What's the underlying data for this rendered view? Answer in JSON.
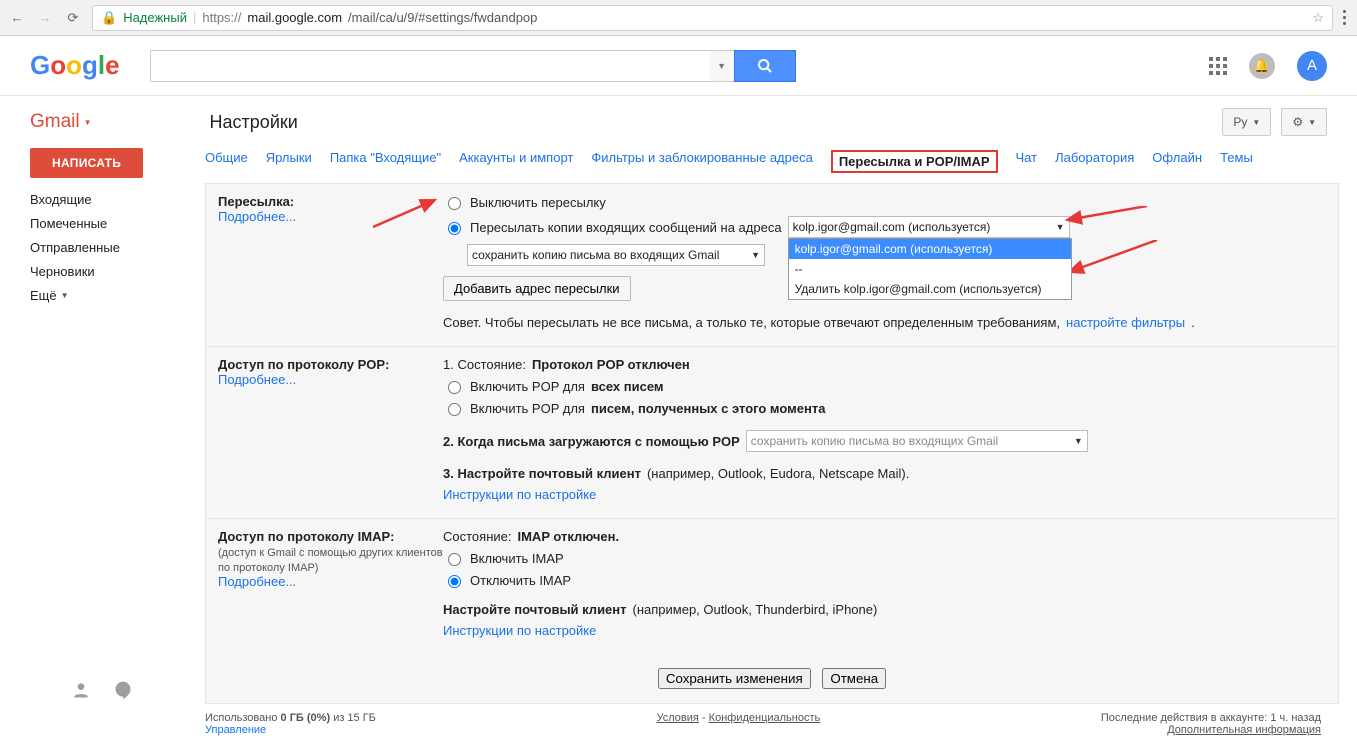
{
  "browser": {
    "secure_label": "Надежный",
    "url_prefix": "https://",
    "url_host": "mail.google.com",
    "url_path": "/mail/ca/u/9/#settings/fwdandpop"
  },
  "header": {
    "gmail_label": "Gmail",
    "page_title": "Настройки",
    "lang_btn": "Ру",
    "avatar_initial": "A"
  },
  "sidebar": {
    "compose": "НАПИСАТЬ",
    "items": [
      "Входящие",
      "Помеченные",
      "Отправленные",
      "Черновики"
    ],
    "more": "Ещё"
  },
  "tabs": {
    "items": [
      "Общие",
      "Ярлыки",
      "Папка \"Входящие\"",
      "Аккаунты и импорт",
      "Фильтры и заблокированные адреса",
      "Пересылка и POP/IMAP",
      "Чат",
      "Лаборатория",
      "Офлайн",
      "Темы"
    ],
    "active_index": 5
  },
  "forwarding": {
    "title": "Пересылка:",
    "more": "Подробнее...",
    "opt_disable": "Выключить пересылку",
    "opt_forward_prefix": "Пересылать копии входящих сообщений на адреса",
    "select_current": "kolp.igor@gmail.com (используется)",
    "keep_copy_select": "сохранить копию письма во входящих Gmail",
    "dropdown": {
      "opt1": "kolp.igor@gmail.com (используется)",
      "div": "--",
      "opt2": "Удалить kolp.igor@gmail.com (используется)"
    },
    "add_btn": "Добавить адрес пересылки",
    "tip_prefix": "Совет. Чтобы пересылать не все письма, а только те, которые отвечают определенным требованиям, ",
    "tip_link": "настройте фильтры"
  },
  "pop": {
    "title": "Доступ по протоколу POP:",
    "more": "Подробнее...",
    "line1_prefix": "1. Состояние: ",
    "line1_bold": "Протокол POP отключен",
    "opt_all_prefix": "Включить POP для ",
    "opt_all_bold": "всех писем",
    "opt_new_prefix": "Включить POP для ",
    "opt_new_bold": "писем, полученных с этого момента",
    "line2": "2. Когда письма загружаются с помощью POP",
    "line2_select": "сохранить копию письма во входящих Gmail",
    "line3_bold": "3. Настройте почтовый клиент",
    "line3_rest": " (например, Outlook, Eudora, Netscape Mail).",
    "line3_link": "Инструкции по настройке"
  },
  "imap": {
    "title": "Доступ по протоколу IMAP:",
    "hint": "(доступ к Gmail с помощью других клиентов по протоколу IMAP)",
    "more": "Подробнее...",
    "status_prefix": "Состояние: ",
    "status_bold": "IMAP отключен.",
    "opt_on": "Включить IMAP",
    "opt_off": "Отключить IMAP",
    "conf_bold": "Настройте почтовый клиент",
    "conf_rest": " (например, Outlook, Thunderbird, iPhone)",
    "conf_link": "Инструкции по настройке"
  },
  "buttons": {
    "save": "Сохранить изменения",
    "cancel": "Отмена"
  },
  "footer": {
    "usage_pre": "Использовано ",
    "usage_bold": "0 ГБ (0%)",
    "usage_post": " из 15 ГБ",
    "manage": "Управление",
    "terms": "Условия",
    "privacy": "Конфиденциальность",
    "activity": "Последние действия в аккаунте: 1 ч. назад",
    "details": "Дополнительная информация"
  }
}
